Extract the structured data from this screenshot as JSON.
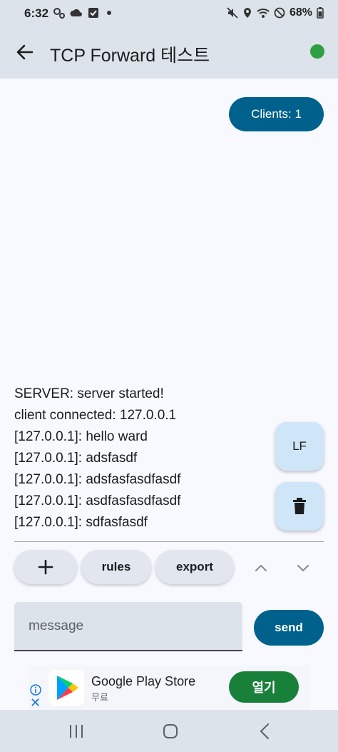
{
  "status_bar": {
    "time": "6:32",
    "battery": "68%",
    "left_icons": [
      "settings-icon",
      "cloud-icon",
      "check-box-icon",
      "dot-icon"
    ],
    "right_icons": [
      "mute-icon",
      "location-icon",
      "wifi-icon",
      "do-not-disturb-icon",
      "battery-icon"
    ]
  },
  "app_bar": {
    "title": "TCP Forward 테스트",
    "connection_color": "#2ea043"
  },
  "clients_button": {
    "label": "Clients: 1"
  },
  "log": [
    "SERVER: server started!",
    "client connected: 127.0.0.1",
    "[127.0.0.1]: hello ward",
    "[127.0.0.1]: adsfasdf",
    "[127.0.0.1]: adsfasfasdfasdf",
    "[127.0.0.1]: asdfasfasdfasdf",
    "[127.0.0.1]: sdfasfasdf"
  ],
  "fabs": {
    "lf_label": "LF",
    "delete_icon": "trash-icon"
  },
  "toolbar": {
    "add_icon": "plus-icon",
    "rules_label": "rules",
    "export_label": "export",
    "up_icon": "chevron-up-icon",
    "down_icon": "chevron-down-icon"
  },
  "composer": {
    "placeholder": "message",
    "value": "",
    "send_label": "send"
  },
  "ad": {
    "app_name": "Google Play Store",
    "subtitle": "무료",
    "open_label": "열기"
  },
  "colors": {
    "primary": "#00628c",
    "surface": "#f8f9ff",
    "bar": "#dde3ea",
    "fab": "#cfe6f8",
    "ad_button": "#188038"
  }
}
